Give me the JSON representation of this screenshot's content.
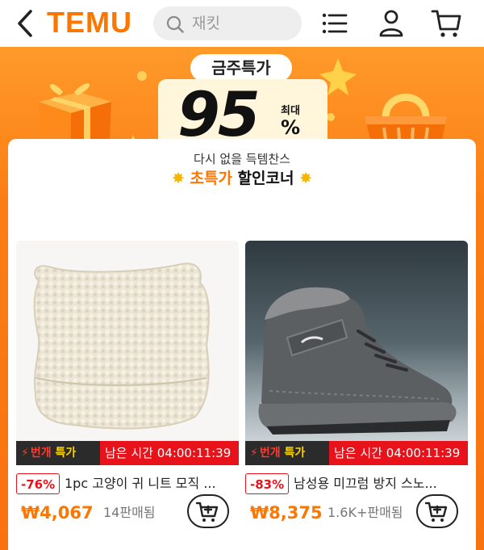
{
  "header": {
    "logo": "TEMU",
    "search_placeholder": "재킷"
  },
  "banner": {
    "pill_label": "금주특가",
    "discount_number": "95",
    "max_label": "최대",
    "percent_sign": "%"
  },
  "card": {
    "subtitle": "다시 없을 득템찬스",
    "title_highlight": "초특가",
    "title_rest": "할인코너",
    "star": "✸",
    "flash_label_a": "번개",
    "flash_label_b": "특가",
    "products": [
      {
        "discount": "-76%",
        "name": "1pc 고양이 귀 니트 모직 ...",
        "price": "₩4,067",
        "sold": "14판매됨",
        "time_left": "남은 시간 04:00:11:39"
      },
      {
        "discount": "-83%",
        "name": "남성용 미끄럼 방지 스노...",
        "price": "₩8,375",
        "sold": "1.6K+판매됨",
        "time_left": "남은 시간 04:00:11:39"
      }
    ]
  },
  "colors": {
    "brand_orange": "#fb7701",
    "flash_red": "#e8121b"
  },
  "icons": [
    "back-arrow-icon",
    "search-icon",
    "menu-list-icon",
    "user-icon",
    "cart-icon",
    "gift-box-icon",
    "basket-icon",
    "star-sparkle-icon",
    "lightning-icon",
    "add-to-cart-icon"
  ]
}
